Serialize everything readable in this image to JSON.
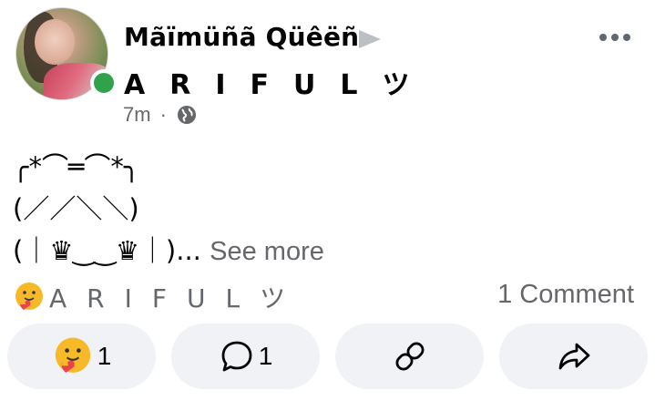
{
  "post": {
    "author_name": "Mãïmüñã Qüêëñ",
    "group_name": "ARIFULツ",
    "time": "7m",
    "separator": "·",
    "privacy_icon": "globe-icon",
    "more_icon": "more-options-icon",
    "online_status_color": "#31a24c",
    "body_line1": "╭*⌒═⌒*╮",
    "body_line2": "(／／＼＼)",
    "body_line3": "(｜♛‿‿♛｜)",
    "body_ellipsis": "...",
    "see_more": "See more"
  },
  "reactions": {
    "icon": "care-hug-emoji",
    "names": "ARIFULツ",
    "comment_count_label": "1 Comment"
  },
  "actions": {
    "react_count": "1",
    "comment_count": "1",
    "react_icon": "care-hug-emoji",
    "comment_icon": "comment-bubble-icon",
    "link_icon": "link-icon",
    "share_icon": "share-arrow-icon",
    "button_bg": "#f0f2f5"
  }
}
